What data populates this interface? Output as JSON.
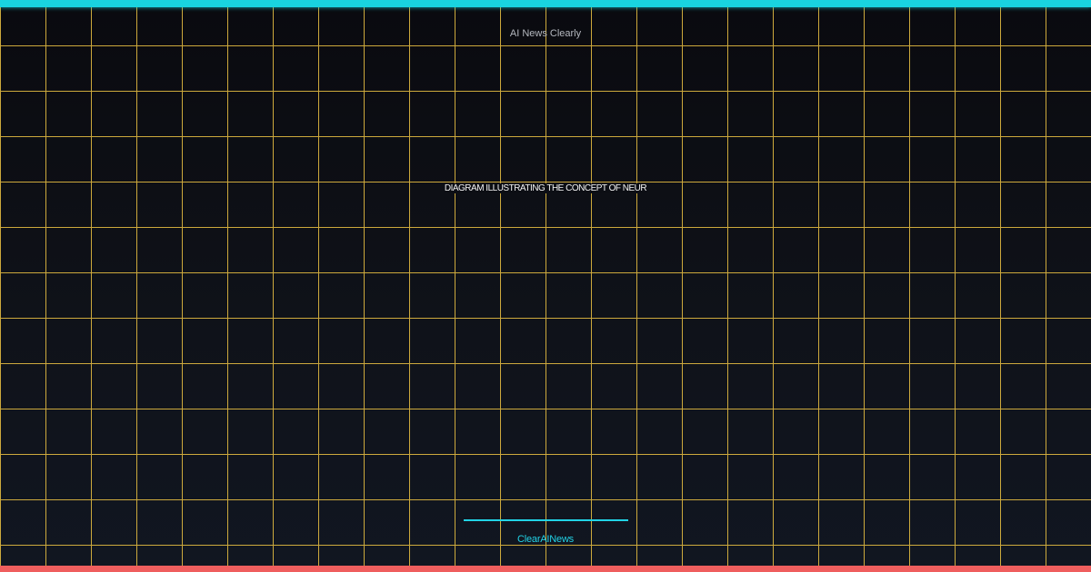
{
  "site": {
    "name": "AI News Clearly"
  },
  "headline": {
    "text": "DIAGRAM ILLUSTRATING THE CONCEPT OF NEUR"
  },
  "footer": {
    "brand": "ClearAINews"
  },
  "colors": {
    "top_bar": "#19d3e0",
    "bottom_bar": "#ef5e5e",
    "grid": "#d8b23f",
    "accent": "#22d3e6",
    "background": "#0d0f15"
  }
}
